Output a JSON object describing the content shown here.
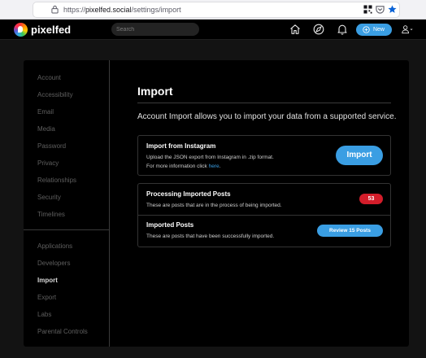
{
  "browser": {
    "url_prefix": "https://",
    "url_host": "pixelfed.social",
    "url_path": "/settings/import"
  },
  "header": {
    "brand": "pixelfed",
    "search_placeholder": "Search",
    "new_label": "New",
    "accent_color": "#3a9ee3"
  },
  "sidebar": {
    "groups": [
      [
        "Account",
        "Accessibility",
        "Email",
        "Media",
        "Password",
        "Privacy",
        "Relationships",
        "Security",
        "Timelines"
      ],
      [
        "Applications",
        "Developers",
        "Import",
        "Export",
        "Labs",
        "Parental Controls"
      ]
    ],
    "active": "Import"
  },
  "main": {
    "title": "Import",
    "lead": "Account Import allows you to import your data from a supported service.",
    "instagram": {
      "title": "Import from Instagram",
      "desc1": "Upload the JSON export from Instagram in .zip format.",
      "desc2_prefix": "For more information click ",
      "desc2_link": "here",
      "desc2_suffix": ".",
      "button": "Import"
    },
    "processing": {
      "title": "Processing Imported Posts",
      "desc": "These are posts that are in the process of being imported.",
      "count": "53"
    },
    "imported": {
      "title": "Imported Posts",
      "desc": "These are posts that have been successfully imported.",
      "button": "Review 15 Posts"
    }
  }
}
